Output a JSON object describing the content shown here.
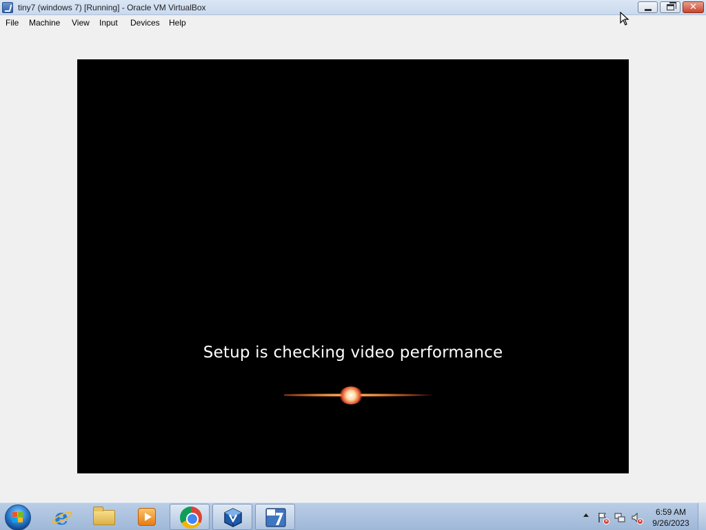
{
  "window": {
    "title": "tiny7 (windows 7) [Running] - Oracle VM VirtualBox",
    "app_icon": "virtualbox-vm-icon",
    "controls": [
      "minimize-icon",
      "restore-icon",
      "close-icon"
    ]
  },
  "menu": {
    "items": [
      {
        "label": "File"
      },
      {
        "label": "Machine"
      },
      {
        "label": "View"
      },
      {
        "label": "Input"
      },
      {
        "label": "Devices"
      },
      {
        "label": "Help"
      }
    ]
  },
  "vm_display": {
    "message": "Setup is checking video performance",
    "background_color": "#000000",
    "text_color": "#ffffff"
  },
  "taskbar": {
    "start_icon": "windows-start-orb-icon",
    "pinned": [
      {
        "icon": "internet-explorer-icon",
        "active": false
      },
      {
        "icon": "file-explorer-icon",
        "active": false
      },
      {
        "icon": "media-player-icon",
        "active": false
      },
      {
        "icon": "chrome-icon",
        "active": true
      },
      {
        "icon": "virtualbox-icon",
        "active": true
      },
      {
        "icon": "virtualbox-vm-icon",
        "active": true
      }
    ],
    "tray": {
      "icons": [
        "show-hidden-icons-icon",
        "action-center-flag-icon",
        "network-icon",
        "volume-muted-icon"
      ],
      "time": "6:59 AM",
      "date": "9/26/2023"
    }
  },
  "colors": {
    "titlebar": "#c9d9ee",
    "taskbar": "#a9c0de",
    "close_button": "#c8452c",
    "window_body": "#f0f0f0"
  }
}
